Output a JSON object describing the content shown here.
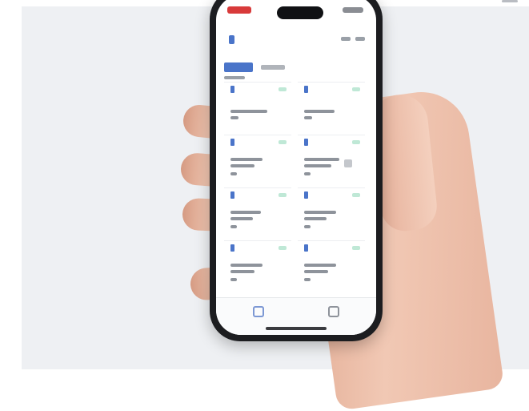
{
  "scene": {
    "backdrop_color": "#eef0f3",
    "skin_color": "#f0c5b0"
  },
  "phone_screen": {
    "app_title": "",
    "accent_color": "#4a74c9",
    "badge_color": "#bfe8d6",
    "icons": [
      "app-logo-icon",
      "nav-home-icon",
      "nav-settings-icon"
    ]
  }
}
